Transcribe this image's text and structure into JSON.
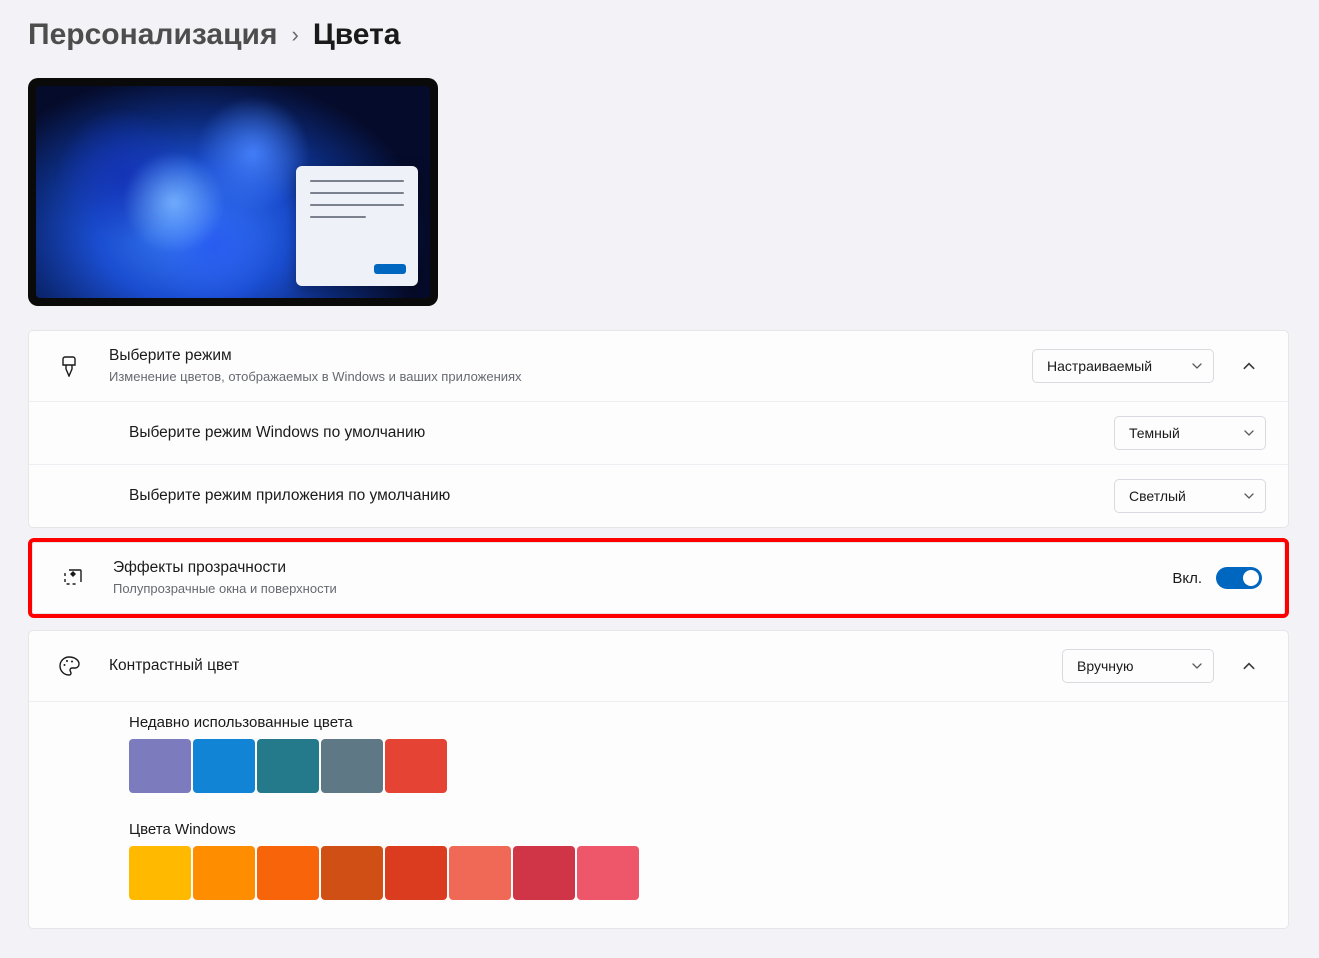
{
  "breadcrumb": {
    "parent": "Персонализация",
    "current": "Цвета"
  },
  "mode": {
    "title": "Выберите режим",
    "desc": "Изменение цветов, отображаемых в Windows и ваших приложениях",
    "value": "Настраиваемый",
    "windowsModeLabel": "Выберите режим Windows по умолчанию",
    "windowsModeValue": "Темный",
    "appModeLabel": "Выберите режим приложения по умолчанию",
    "appModeValue": "Светлый"
  },
  "transparency": {
    "title": "Эффекты прозрачности",
    "desc": "Полупрозрачные окна и поверхности",
    "stateLabel": "Вкл."
  },
  "accent": {
    "title": "Контрастный цвет",
    "value": "Вручную",
    "recentLabel": "Недавно использованные цвета",
    "recentColors": [
      "#7b7bbe",
      "#1284d6",
      "#247a8a",
      "#5f7885",
      "#e54334"
    ],
    "windowsLabel": "Цвета Windows",
    "windowsColors": [
      "#ffba00",
      "#ff8d00",
      "#f7640a",
      "#cf4f14",
      "#db3b1f",
      "#f06957",
      "#d03547",
      "#ee5769"
    ]
  }
}
